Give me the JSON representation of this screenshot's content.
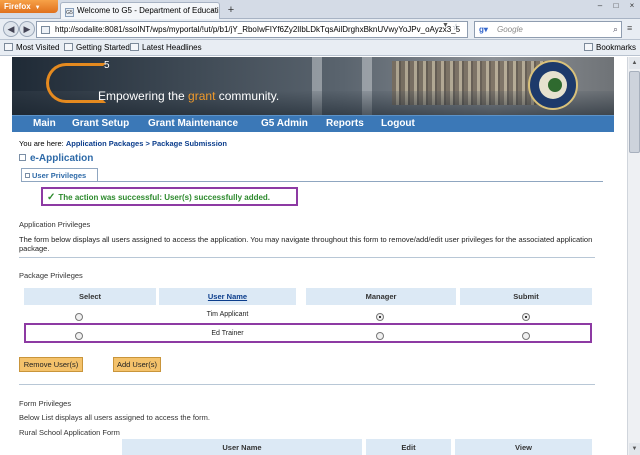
{
  "browser": {
    "app_button": "Firefox",
    "tab_title": "Welcome to G5 - Department of Educatio...",
    "tab_favicon": "G5",
    "url": "http://sodalite:8081/ssoINT/wps/myportal/!ut/p/b1/jY_RboIwFIYf6Zy2lIbLDkTqsAilDrghxBknUVwyYoJPv_oAyzx3_5",
    "search_placeholder": "Google",
    "bookmarks": [
      "Most Visited",
      "Getting Started",
      "Latest Headlines"
    ],
    "bookmarks_right": "Bookmarks"
  },
  "banner": {
    "logo_superscript": "5",
    "tagline_pre": "Empowering the ",
    "tagline_accent": "grant",
    "tagline_post": " community.",
    "accent_color": "#f19a2a"
  },
  "menu": [
    "Main",
    "Grant Setup",
    "Grant Maintenance",
    "G5 Admin",
    "Reports",
    "Logout"
  ],
  "breadcrumb": {
    "prefix": "You are here: ",
    "item1": "Application Packages",
    "sep": " > ",
    "item2": "Package Submission"
  },
  "section_title": "e-Application",
  "subtab": "User Privileges",
  "success_message": "The action was successful: User(s) successfully added.",
  "app_privileges": {
    "heading": "Application Privileges",
    "description": "The form below displays all users assigned to access the application. You may navigate throughout this form to remove/add/edit user privileges for the associated application package."
  },
  "package_privileges": {
    "heading": "Package Privileges",
    "columns": [
      "Select",
      "User Name",
      "Manager",
      "Submit"
    ],
    "rows": [
      {
        "name": "Tim Applicant",
        "select": false,
        "manager": true,
        "submit": true
      },
      {
        "name": "Ed Trainer",
        "select": false,
        "manager": false,
        "submit": false
      }
    ],
    "remove_button": "Remove User(s)",
    "add_button": "Add User(s)"
  },
  "form_privileges": {
    "heading": "Form Privileges",
    "description": "Below List displays all users assigned to access the form.",
    "form_name": "Rural School Application Form",
    "columns": [
      "User Name",
      "Edit",
      "View"
    ]
  },
  "colors": {
    "menu_bar": "#3b78b7",
    "highlight_border": "#8d3aa3",
    "success_text": "#2d8a2d",
    "button": "#f4c26b",
    "table_header": "#dce9f5"
  }
}
